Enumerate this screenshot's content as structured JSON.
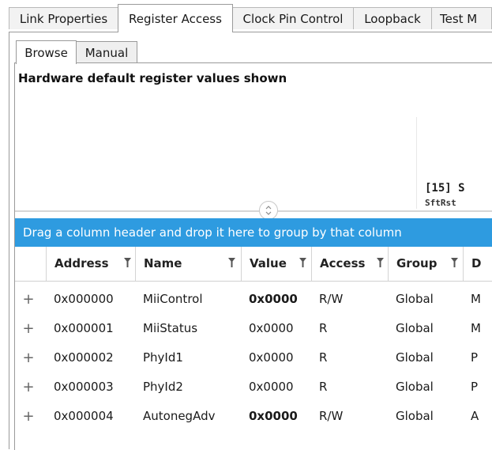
{
  "tabs": [
    "Link Properties",
    "Register Access",
    "Clock Pin Control",
    "Loopback",
    "Test M"
  ],
  "subtabs": [
    "Browse",
    "Manual"
  ],
  "browse": {
    "note": "Hardware default register values shown",
    "bitview_label": "[15] S",
    "bitview_sub": "SftRst"
  },
  "grid": {
    "group_hint": "Drag a column header and drop it here to group by that column",
    "columns": [
      "Address",
      "Name",
      "Value",
      "Access",
      "Group",
      "D"
    ],
    "rows": [
      {
        "address": "0x000000",
        "name": "MiiControl",
        "value": "0x0000",
        "access": "R/W",
        "group": "Global",
        "desc": "M",
        "value_bold": true
      },
      {
        "address": "0x000001",
        "name": "MiiStatus",
        "value": "0x0000",
        "access": "R",
        "group": "Global",
        "desc": "M",
        "value_bold": false
      },
      {
        "address": "0x000002",
        "name": "PhyId1",
        "value": "0x0000",
        "access": "R",
        "group": "Global",
        "desc": "P",
        "value_bold": false
      },
      {
        "address": "0x000003",
        "name": "PhyId2",
        "value": "0x0000",
        "access": "R",
        "group": "Global",
        "desc": "P",
        "value_bold": false
      },
      {
        "address": "0x000004",
        "name": "AutonegAdv",
        "value": "0x0000",
        "access": "R/W",
        "group": "Global",
        "desc": "A",
        "value_bold": true
      }
    ],
    "expander_glyph": "+"
  }
}
